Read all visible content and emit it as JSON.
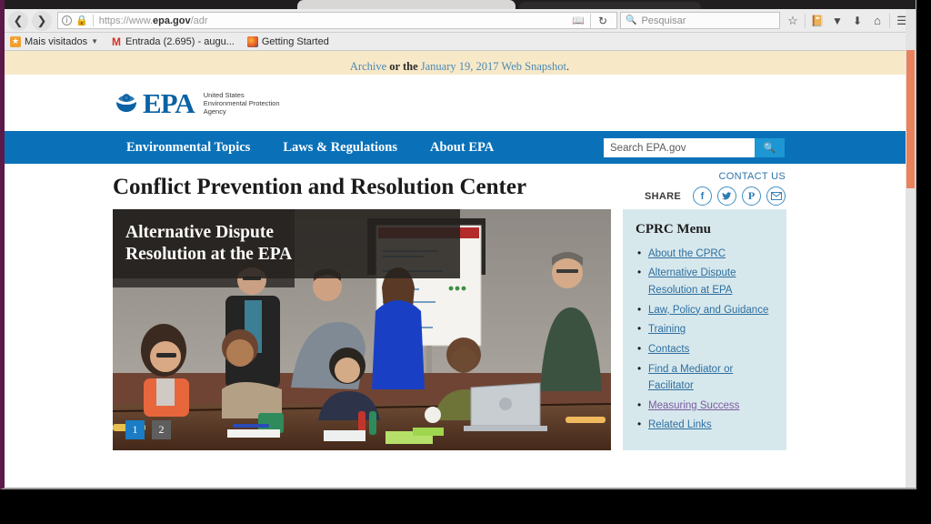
{
  "browser": {
    "nav": {
      "back_icon": "back-arrow-icon",
      "forward_icon": "forward-arrow-icon",
      "info_label": "i",
      "lock_icon": "padlock-icon",
      "url_prefix": "https://www.",
      "url_domain": "epa.gov",
      "url_path": "/adr",
      "reader_icon": "reader-view-icon",
      "reload_icon": "reload-icon"
    },
    "search": {
      "placeholder": "Pesquisar",
      "icon": "search-icon"
    },
    "toolbar_icons": [
      {
        "name": "bookmark-star-icon",
        "glyph": "☆"
      },
      {
        "name": "library-icon",
        "glyph": "Ὅ2"
      },
      {
        "name": "pocket-icon",
        "glyph": "▽"
      },
      {
        "name": "downloads-icon",
        "glyph": "⬇"
      },
      {
        "name": "home-icon",
        "glyph": "⌂"
      },
      {
        "name": "hamburger-menu-icon",
        "glyph": "☰"
      }
    ],
    "bookmarks": [
      {
        "label": "Mais visitados",
        "icon": "most-visited-icon",
        "has_caret": true
      },
      {
        "label": "Entrada (2.695) - augu...",
        "icon": "gmail-icon",
        "has_caret": false
      },
      {
        "label": "Getting Started",
        "icon": "firefox-icon",
        "has_caret": false
      }
    ]
  },
  "page": {
    "archive_notice": {
      "link1": "Archive",
      "middle": " or the ",
      "link2": "January 19, 2017 Web Snapshot",
      "period": "."
    },
    "logo": {
      "wordmark": "EPA",
      "line1": "United States",
      "line2": "Environmental Protection",
      "line3": "Agency"
    },
    "nav_links": [
      "Environmental Topics",
      "Laws & Regulations",
      "About EPA"
    ],
    "site_search": {
      "placeholder": "Search EPA.gov",
      "button_icon": "search-icon"
    },
    "title": "Conflict Prevention and Resolution Center",
    "contact_us": "CONTACT US",
    "share_label": "SHARE",
    "share_buttons": [
      {
        "name": "facebook-share-icon",
        "glyph": "f"
      },
      {
        "name": "twitter-share-icon",
        "glyph": "✐"
      },
      {
        "name": "pinterest-share-icon",
        "glyph": "℗"
      },
      {
        "name": "email-share-icon",
        "glyph": "✉"
      }
    ],
    "hero": {
      "caption_line1": "Alternative Dispute",
      "caption_line2": "Resolution at the EPA",
      "slides": [
        {
          "label": "1",
          "active": true
        },
        {
          "label": "2",
          "active": false
        }
      ]
    },
    "sidebar": {
      "title": "CPRC Menu",
      "items": [
        {
          "label": "About the CPRC",
          "visited": false
        },
        {
          "label": "Alternative Dispute Resolution at EPA",
          "visited": false
        },
        {
          "label": "Law, Policy and Guidance",
          "visited": false
        },
        {
          "label": "Training",
          "visited": false
        },
        {
          "label": "Contacts",
          "visited": false
        },
        {
          "label": "Find a Mediator or Facilitator",
          "visited": false
        },
        {
          "label": "Measuring Success",
          "visited": true
        },
        {
          "label": "Related Links ",
          "visited": false
        }
      ]
    }
  },
  "colors": {
    "epa_blue": "#0a71b9",
    "link_blue": "#2e6f9e",
    "visited_purple": "#7b5ba0",
    "sidebar_bg": "#d7e8ed",
    "notice_bg": "#f7e8c8",
    "scrollbar_thumb": "#e8815c"
  }
}
